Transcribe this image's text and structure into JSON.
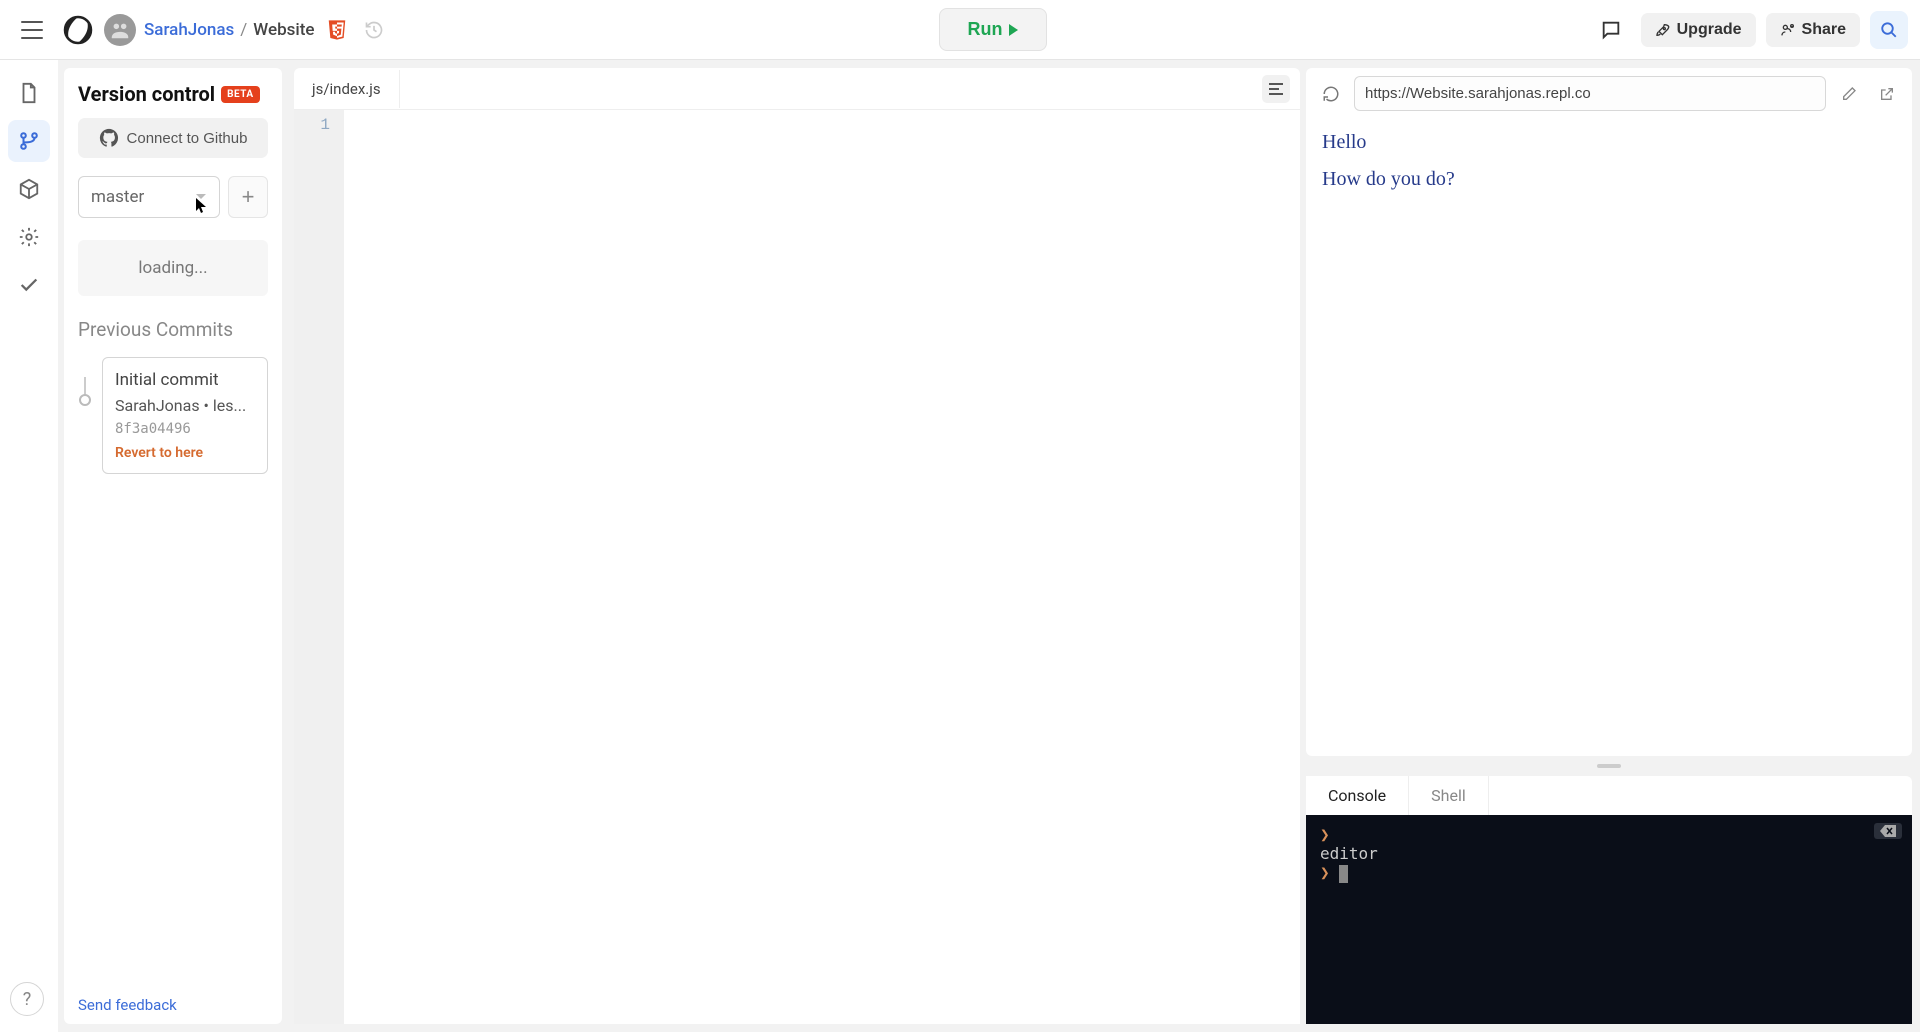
{
  "header": {
    "user": "SarahJonas",
    "separator": "/",
    "project": "Website",
    "run_label": "Run",
    "upgrade_label": "Upgrade",
    "share_label": "Share"
  },
  "vc": {
    "title": "Version control",
    "beta": "BETA",
    "connect_gh": "Connect to Github",
    "branch": "master",
    "loading": "loading...",
    "prev_commits": "Previous Commits",
    "commit": {
      "title": "Initial commit",
      "author_line": "SarahJonas • les...",
      "hash": "8f3a04496",
      "revert": "Revert to here"
    },
    "feedback": "Send feedback"
  },
  "editor": {
    "tab": "js/index.js",
    "line_no": "1"
  },
  "browser": {
    "url": "https://Website.sarahjonas.repl.co",
    "line1": "Hello",
    "line2": "How do you do?"
  },
  "terminal": {
    "tab_console": "Console",
    "tab_shell": "Shell",
    "output_line": "editor"
  }
}
